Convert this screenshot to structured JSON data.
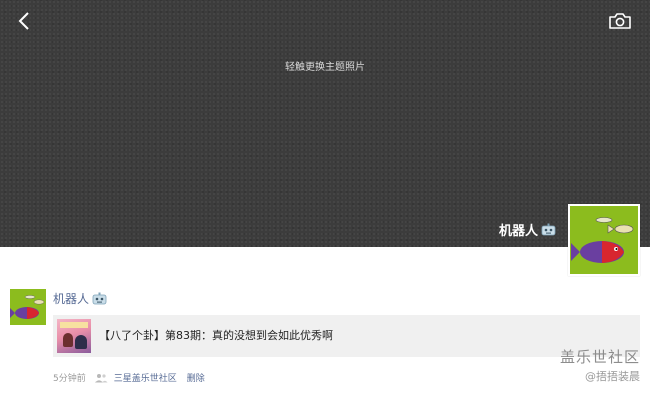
{
  "cover": {
    "hint": "轻触更换主题照片"
  },
  "icons": {
    "back": "chevron-left-icon",
    "camera": "camera-icon",
    "people": "people-icon",
    "bot": "robot-emoji-icon"
  },
  "profile": {
    "name": "机器人"
  },
  "post": {
    "author": "机器人",
    "link_title": "【八了个卦】第83期：真的没想到会如此优秀啊",
    "time": "5分钟前",
    "group": "三星盖乐世社区",
    "delete_label": "删除"
  },
  "watermark": {
    "main": "盖乐世社区",
    "sub": "@捂捂装晨"
  },
  "colors": {
    "cover_bg": "#3c3c3c",
    "link_blue": "#576b95",
    "avatar_green": "#8cbc1e",
    "card_bg": "#f0f0f0"
  }
}
